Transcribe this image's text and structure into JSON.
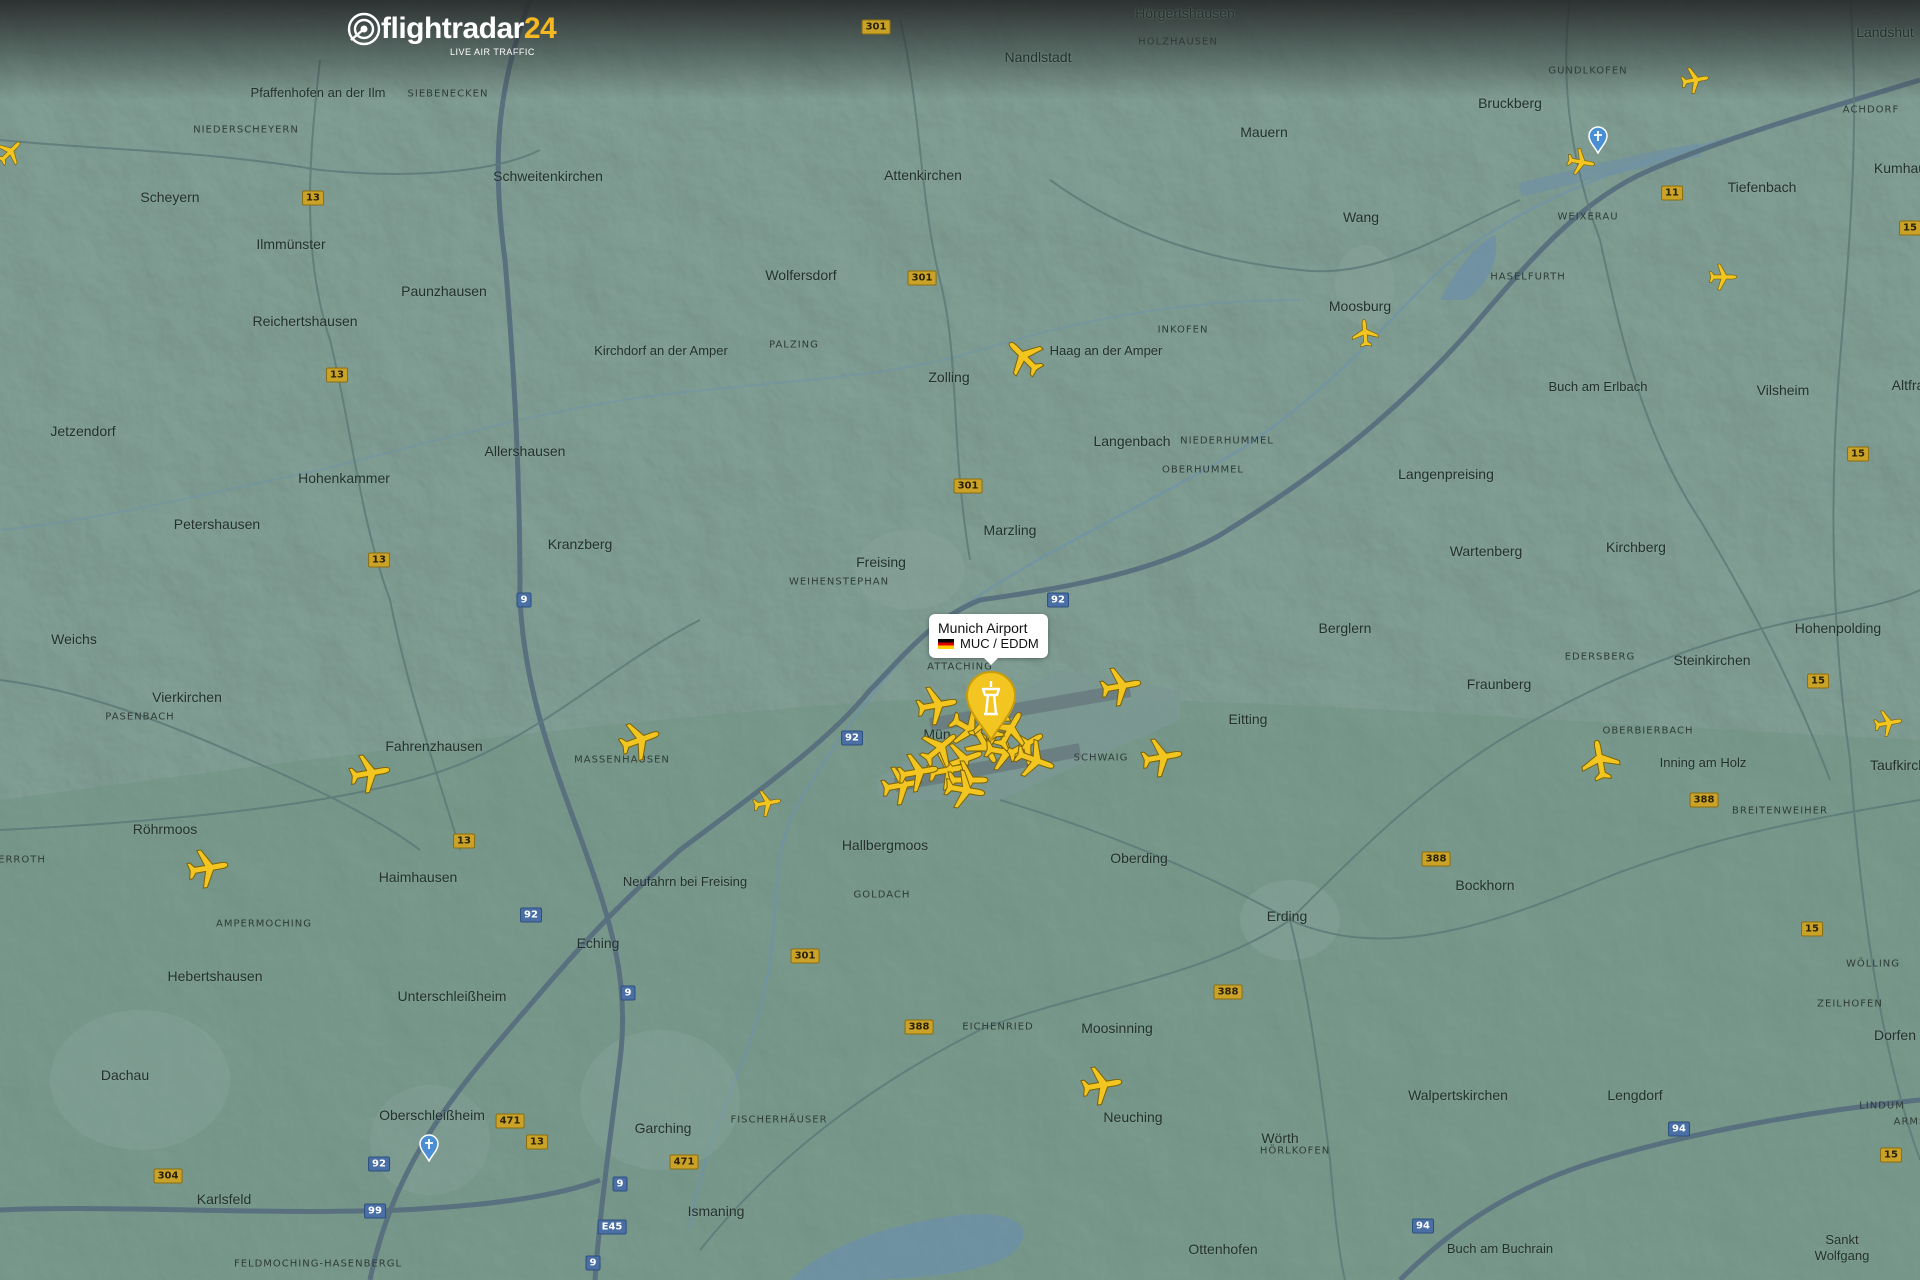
{
  "app": {
    "brand_name": "flightradar",
    "brand_number": "24",
    "tagline": "LIVE AIR TRAFFIC",
    "accent_color": "#f5b820",
    "aircraft_color": "#f2c521"
  },
  "airport_popup": {
    "name": "Munich Airport",
    "code": "MUC / EDDM",
    "flag_icon": "germany-flag-icon"
  },
  "towns": [
    {
      "id": "nandlstadt",
      "label": "Nandlstadt"
    },
    {
      "id": "hoergertshausen",
      "label": "Hörgertshausen"
    },
    {
      "id": "landshut",
      "label": "Landshut"
    },
    {
      "id": "pfaffenhofen",
      "label": "Pfaffenhofen an der Ilm"
    },
    {
      "id": "mauern",
      "label": "Mauern"
    },
    {
      "id": "bruckberg",
      "label": "Bruckberg"
    },
    {
      "id": "scheyern",
      "label": "Scheyern"
    },
    {
      "id": "schweitenkirchen",
      "label": "Schweitenkirchen"
    },
    {
      "id": "attenkirchen",
      "label": "Attenkirchen"
    },
    {
      "id": "wang",
      "label": "Wang"
    },
    {
      "id": "tiefenbach",
      "label": "Tiefenbach"
    },
    {
      "id": "kumhausen",
      "label": "Kumhau"
    },
    {
      "id": "ilmmuenster",
      "label": "Ilmmünster"
    },
    {
      "id": "wolfersdorf",
      "label": "Wolfersdorf"
    },
    {
      "id": "paunzhausen",
      "label": "Paunzhausen"
    },
    {
      "id": "moosburg",
      "label": "Moosburg"
    },
    {
      "id": "reichertshausen",
      "label": "Reichertshausen"
    },
    {
      "id": "kirchdorf",
      "label": "Kirchdorf an der Amper"
    },
    {
      "id": "haag",
      "label": "Haag an der Amper"
    },
    {
      "id": "zolling",
      "label": "Zolling"
    },
    {
      "id": "buch-erlbach",
      "label": "Buch am Erlbach"
    },
    {
      "id": "vilsheim",
      "label": "Vilsheim"
    },
    {
      "id": "altfra",
      "label": "Altfra"
    },
    {
      "id": "jetzendorf",
      "label": "Jetzendorf"
    },
    {
      "id": "langenbach",
      "label": "Langenbach"
    },
    {
      "id": "allershausen",
      "label": "Allershausen"
    },
    {
      "id": "hohenkammer",
      "label": "Hohenkammer"
    },
    {
      "id": "langenpreising",
      "label": "Langenpreising"
    },
    {
      "id": "petershausen",
      "label": "Petershausen"
    },
    {
      "id": "marzling",
      "label": "Marzling"
    },
    {
      "id": "kranzberg",
      "label": "Kranzberg"
    },
    {
      "id": "wartenberg",
      "label": "Wartenberg"
    },
    {
      "id": "kirchberg",
      "label": "Kirchberg"
    },
    {
      "id": "freising",
      "label": "Freising"
    },
    {
      "id": "berglern",
      "label": "Berglern"
    },
    {
      "id": "hohenpolding",
      "label": "Hohenpolding"
    },
    {
      "id": "weichs",
      "label": "Weichs"
    },
    {
      "id": "steinkirchen",
      "label": "Steinkirchen"
    },
    {
      "id": "fraunberg",
      "label": "Fraunberg"
    },
    {
      "id": "vierkirchen",
      "label": "Vierkirchen"
    },
    {
      "id": "eitting",
      "label": "Eitting"
    },
    {
      "id": "fahrenzhausen",
      "label": "Fahrenzhausen"
    },
    {
      "id": "muenchen-airport-town",
      "label": "Mün"
    },
    {
      "id": "inning",
      "label": "Inning am Holz"
    },
    {
      "id": "taufkirchen",
      "label": "Taufkirch"
    },
    {
      "id": "roehrmoos",
      "label": "Röhrmoos"
    },
    {
      "id": "hallbergmoos",
      "label": "Hallbergmoos"
    },
    {
      "id": "oberding",
      "label": "Oberding"
    },
    {
      "id": "neufahrn",
      "label": "Neufahrn bei Freising"
    },
    {
      "id": "haimhausen",
      "label": "Haimhausen"
    },
    {
      "id": "bockhorn",
      "label": "Bockhorn"
    },
    {
      "id": "erding",
      "label": "Erding"
    },
    {
      "id": "eching",
      "label": "Eching"
    },
    {
      "id": "hebertshausen",
      "label": "Hebertshausen"
    },
    {
      "id": "unterschleissheim",
      "label": "Unterschleißheim"
    },
    {
      "id": "moosinning",
      "label": "Moosinning"
    },
    {
      "id": "dorfen",
      "label": "Dorfen"
    },
    {
      "id": "dachau",
      "label": "Dachau"
    },
    {
      "id": "walpertskirchen",
      "label": "Walpertskirchen"
    },
    {
      "id": "lengdorf",
      "label": "Lengdorf"
    },
    {
      "id": "oberschleissheim",
      "label": "Oberschleißheim"
    },
    {
      "id": "neuching",
      "label": "Neuching"
    },
    {
      "id": "garching",
      "label": "Garching"
    },
    {
      "id": "woerth",
      "label": "Wörth"
    },
    {
      "id": "karlsfeld",
      "label": "Karlsfeld"
    },
    {
      "id": "ismaning",
      "label": "Ismaning"
    },
    {
      "id": "ottenhofen",
      "label": "Ottenhofen"
    },
    {
      "id": "buch-buchrain",
      "label": "Buch am Buchrain"
    },
    {
      "id": "sankt-wolfgang",
      "label": "Sankt Wolfgang"
    }
  ],
  "localities": [
    {
      "id": "holzhausen",
      "label": "HOLZHAUSEN"
    },
    {
      "id": "siebenecken",
      "label": "SIEBENECKEN"
    },
    {
      "id": "gundlkofen",
      "label": "GUNDLKOFEN"
    },
    {
      "id": "achdorf",
      "label": "ACHDORF"
    },
    {
      "id": "niederscheyern",
      "label": "NIEDERSCHEYERN"
    },
    {
      "id": "weixerau",
      "label": "WEIXERAU"
    },
    {
      "id": "haselfurth",
      "label": "HASELFURTH"
    },
    {
      "id": "palzing",
      "label": "PALZING"
    },
    {
      "id": "inkofen",
      "label": "INKOFEN"
    },
    {
      "id": "niederhummel",
      "label": "NIEDERHUMMEL"
    },
    {
      "id": "oberhummel",
      "label": "OBERHUMMEL"
    },
    {
      "id": "weihenstephan",
      "label": "WEIHENSTEPHAN"
    },
    {
      "id": "attaching",
      "label": "ATTACHING"
    },
    {
      "id": "edersberg",
      "label": "EDERSBERG"
    },
    {
      "id": "pasenbach",
      "label": "PASENBACH"
    },
    {
      "id": "oberbierbach",
      "label": "OBERBIERBACH"
    },
    {
      "id": "massenhausen",
      "label": "MASSENHAUSEN"
    },
    {
      "id": "schwaig",
      "label": "SCHWAIG"
    },
    {
      "id": "breitenweiher",
      "label": "BREITENWEIHER"
    },
    {
      "id": "erroth",
      "label": "ERROTH"
    },
    {
      "id": "goldach",
      "label": "GOLDACH"
    },
    {
      "id": "ampermoching",
      "label": "AMPERMOCHING"
    },
    {
      "id": "woelling",
      "label": "WÖLLING"
    },
    {
      "id": "zeilhofen",
      "label": "ZEILHOFEN"
    },
    {
      "id": "eichenried",
      "label": "EICHENRIED"
    },
    {
      "id": "lindum",
      "label": "LINDUM"
    },
    {
      "id": "arms",
      "label": "ARMS"
    },
    {
      "id": "fischerhaeuser",
      "label": "FISCHERHÄUSER"
    },
    {
      "id": "hoerlkofen",
      "label": "HÖRLKOFEN"
    },
    {
      "id": "feldmoching",
      "label": "FELDMOCHING-HASENBERGL"
    }
  ],
  "road_shields": [
    {
      "id": "r301a",
      "label": "301",
      "type": "federal"
    },
    {
      "id": "r13a",
      "label": "13",
      "type": "federal"
    },
    {
      "id": "r11",
      "label": "11",
      "type": "federal"
    },
    {
      "id": "r15a",
      "label": "15",
      "type": "federal"
    },
    {
      "id": "r301b",
      "label": "301",
      "type": "federal"
    },
    {
      "id": "r13b",
      "label": "13",
      "type": "federal"
    },
    {
      "id": "r15b",
      "label": "15",
      "type": "federal"
    },
    {
      "id": "r301c",
      "label": "301",
      "type": "federal"
    },
    {
      "id": "r13c",
      "label": "13",
      "type": "federal"
    },
    {
      "id": "r9a",
      "label": "9",
      "type": "autobahn"
    },
    {
      "id": "r92a",
      "label": "92",
      "type": "autobahn"
    },
    {
      "id": "r15c",
      "label": "15",
      "type": "federal"
    },
    {
      "id": "r92b",
      "label": "92",
      "type": "autobahn"
    },
    {
      "id": "r388a",
      "label": "388",
      "type": "federal"
    },
    {
      "id": "r13d",
      "label": "13",
      "type": "federal"
    },
    {
      "id": "r388b",
      "label": "388",
      "type": "federal"
    },
    {
      "id": "r92c",
      "label": "92",
      "type": "autobahn"
    },
    {
      "id": "r15d",
      "label": "15",
      "type": "federal"
    },
    {
      "id": "r301d",
      "label": "301",
      "type": "federal"
    },
    {
      "id": "r9b",
      "label": "9",
      "type": "autobahn"
    },
    {
      "id": "r388c",
      "label": "388",
      "type": "federal"
    },
    {
      "id": "r388d",
      "label": "388",
      "type": "federal"
    },
    {
      "id": "r94a",
      "label": "94",
      "type": "autobahn"
    },
    {
      "id": "r471a",
      "label": "471",
      "type": "federal"
    },
    {
      "id": "r13e",
      "label": "13",
      "type": "federal"
    },
    {
      "id": "r92d",
      "label": "92",
      "type": "autobahn"
    },
    {
      "id": "r471b",
      "label": "471",
      "type": "federal"
    },
    {
      "id": "r15e",
      "label": "15",
      "type": "federal"
    },
    {
      "id": "r304",
      "label": "304",
      "type": "federal"
    },
    {
      "id": "r9c",
      "label": "9",
      "type": "autobahn"
    },
    {
      "id": "r99",
      "label": "99",
      "type": "autobahn"
    },
    {
      "id": "re45",
      "label": "E45",
      "type": "european"
    },
    {
      "id": "r94b",
      "label": "94",
      "type": "autobahn"
    },
    {
      "id": "r9d",
      "label": "9",
      "type": "autobahn"
    }
  ],
  "aircraft_count_visible": 30
}
